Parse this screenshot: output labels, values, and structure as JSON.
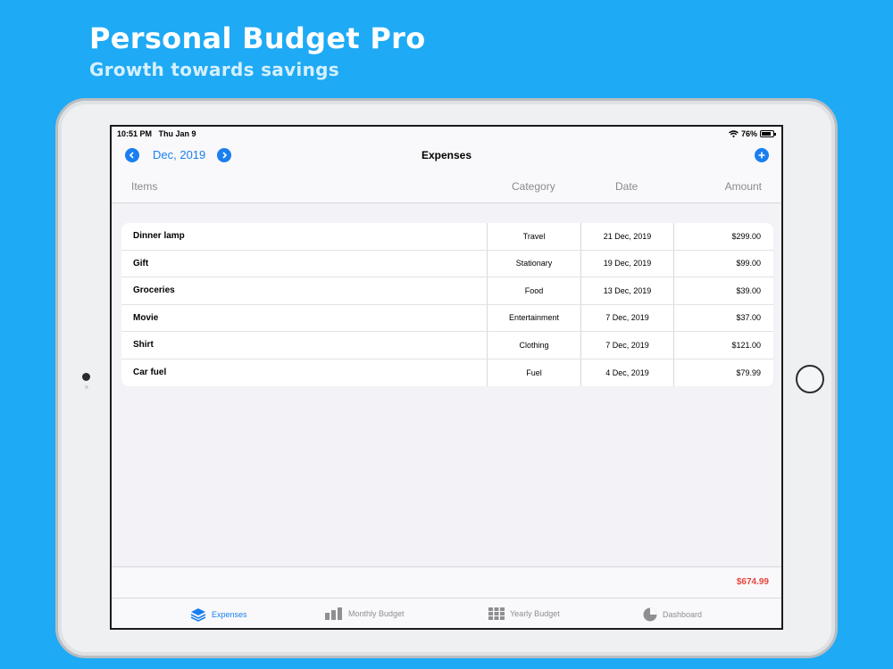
{
  "promo": {
    "title": "Personal Budget Pro",
    "subtitle": "Growth towards savings"
  },
  "status_bar": {
    "time": "10:51 PM",
    "date": "Thu Jan 9",
    "battery": "76%"
  },
  "nav": {
    "month": "Dec, 2019",
    "title": "Expenses",
    "prev_icon": "chevron-left-icon",
    "next_icon": "chevron-right-icon",
    "add_icon": "plus-icon"
  },
  "columns": {
    "items": "Items",
    "category": "Category",
    "date": "Date",
    "amount": "Amount"
  },
  "expenses": [
    {
      "item": "Dinner lamp",
      "category": "Travel",
      "date": "21 Dec, 2019",
      "amount": "$299.00"
    },
    {
      "item": "Gift",
      "category": "Stationary",
      "date": "19 Dec, 2019",
      "amount": "$99.00"
    },
    {
      "item": "Groceries",
      "category": "Food",
      "date": "13 Dec, 2019",
      "amount": "$39.00"
    },
    {
      "item": "Movie",
      "category": "Entertainment",
      "date": "7 Dec, 2019",
      "amount": "$37.00"
    },
    {
      "item": "Shirt",
      "category": "Clothing",
      "date": "7 Dec, 2019",
      "amount": "$121.00"
    },
    {
      "item": "Car fuel",
      "category": "Fuel",
      "date": "4 Dec, 2019",
      "amount": "$79.99"
    }
  ],
  "total": "$674.99",
  "tabs": [
    {
      "label": "Expenses",
      "icon": "layers-icon",
      "active": true
    },
    {
      "label": "Monthly Budget",
      "icon": "bar-chart-icon",
      "active": false
    },
    {
      "label": "Yearly Budget",
      "icon": "grid-icon",
      "active": false
    },
    {
      "label": "Dashboard",
      "icon": "pie-chart-icon",
      "active": false
    }
  ],
  "colors": {
    "background": "#1eaaf5",
    "accent": "#1a7ff0",
    "total": "#e8453c"
  }
}
